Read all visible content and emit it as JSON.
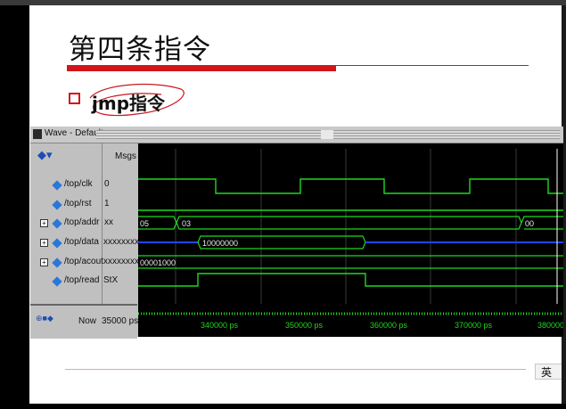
{
  "slide": {
    "title": "第四条指令",
    "bullet": "jmp指令",
    "ime_indicator": "英"
  },
  "wave_window": {
    "title": "Wave - Default",
    "msgs_header": "Msgs",
    "signals": [
      {
        "name": "/top/clk",
        "value": "0",
        "expandable": false
      },
      {
        "name": "/top/rst",
        "value": "1",
        "expandable": false
      },
      {
        "name": "/top/addr",
        "value": "xx",
        "expandable": true
      },
      {
        "name": "/top/data",
        "value": "xxxxxxxx",
        "expandable": true
      },
      {
        "name": "/top/acout",
        "value": "xxxxxxxx",
        "expandable": true
      },
      {
        "name": "/top/read",
        "value": "StX",
        "expandable": false
      }
    ],
    "now_label": "Now",
    "now_value": "35000 ps",
    "bus_labels": {
      "addr_a": "05",
      "addr_b": "03",
      "addr_c": "00",
      "data": "10000000",
      "acout": "00001000"
    },
    "time_ticks": [
      "340000 ps",
      "350000 ps",
      "360000 ps",
      "370000 ps",
      "380000"
    ],
    "colors": {
      "signal": "#1ed81e",
      "bus_x": "#2244ff",
      "cursor": "#ffffff",
      "grid": "#3a3a3a"
    }
  }
}
